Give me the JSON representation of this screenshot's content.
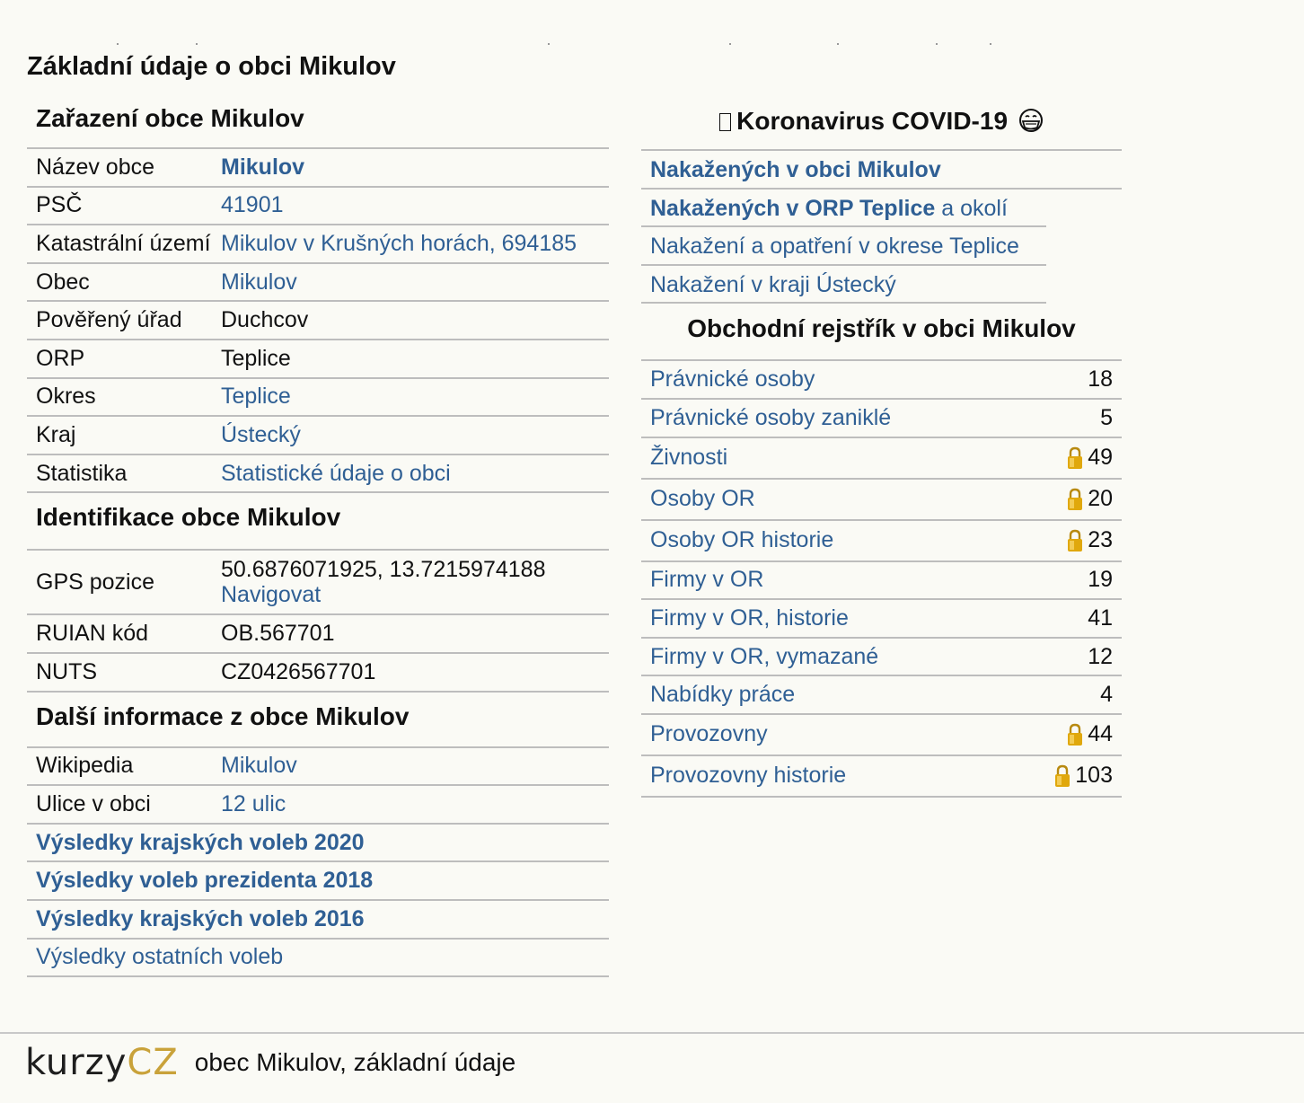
{
  "page_title": "Základní údaje o obci Mikulov",
  "zarazeni": {
    "heading": "Zařazení obce Mikulov",
    "rows": [
      {
        "label": "Název obce",
        "value": "Mikulov",
        "link": true,
        "bold": true
      },
      {
        "label": "PSČ",
        "value": "41901",
        "link": true,
        "bold": false
      },
      {
        "label": "Katastrální území",
        "value": "Mikulov v Krušných horách, 694185",
        "link": true,
        "bold": false
      },
      {
        "label": "Obec",
        "value": "Mikulov",
        "link": true,
        "bold": false
      },
      {
        "label": "Pověřený úřad",
        "value": "Duchcov",
        "link": false,
        "bold": false
      },
      {
        "label": "ORP",
        "value": "Teplice",
        "link": false,
        "bold": false
      },
      {
        "label": "Okres",
        "value": "Teplice",
        "link": true,
        "bold": false
      },
      {
        "label": "Kraj",
        "value": "Ústecký",
        "link": true,
        "bold": false
      },
      {
        "label": "Statistika",
        "value": "Statistické údaje o obci",
        "link": true,
        "bold": false
      }
    ]
  },
  "identifikace": {
    "heading": "Identifikace obce Mikulov",
    "gps_label": "GPS pozice",
    "gps_value": "50.6876071925, 13.7215974188",
    "gps_link": "Navigovat",
    "ruian_label": "RUIAN kód",
    "ruian_value": "OB.567701",
    "nuts_label": "NUTS",
    "nuts_value": "CZ0426567701"
  },
  "dalsi": {
    "heading": "Další informace z obce Mikulov",
    "wiki_label": "Wikipedia",
    "wiki_value": "Mikulov",
    "ulice_label": "Ulice v obci",
    "ulice_value": "12 ulic",
    "links": [
      {
        "text": "Výsledky krajských voleb 2020",
        "bold": true
      },
      {
        "text": "Výsledky voleb prezidenta 2018",
        "bold": true
      },
      {
        "text": "Výsledky krajských voleb 2016",
        "bold": true
      },
      {
        "text": "Výsledky ostatních voleb",
        "bold": false
      }
    ]
  },
  "covid": {
    "heading": "Koronavirus COVID-19",
    "icon": "face-with-mask-icon",
    "rows": [
      {
        "bold_part": "Nakažených v obci Mikulov",
        "rest": ""
      },
      {
        "bold_part": "Nakažených v ORP Teplice",
        "rest": " a okolí"
      },
      {
        "bold_part": "",
        "rest": "Nakažení a opatření v okrese Teplice"
      },
      {
        "bold_part": "",
        "rest": "Nakažení v kraji Ústecký"
      }
    ]
  },
  "obchodni_rejstrik": {
    "heading": "Obchodní rejstřík v obci Mikulov",
    "rows": [
      {
        "name": "Právnické osoby",
        "count": "18",
        "locked": false
      },
      {
        "name": "Právnické osoby zaniklé",
        "count": "5",
        "locked": false
      },
      {
        "name": "Živnosti",
        "count": "49",
        "locked": true
      },
      {
        "name": "Osoby OR",
        "count": "20",
        "locked": true
      },
      {
        "name": "Osoby OR historie",
        "count": "23",
        "locked": true
      },
      {
        "name": "Firmy v OR",
        "count": "19",
        "locked": false
      },
      {
        "name": "Firmy v OR, historie",
        "count": "41",
        "locked": false
      },
      {
        "name": "Firmy v OR, vymazané",
        "count": "12",
        "locked": false
      },
      {
        "name": "Nabídky práce",
        "count": "4",
        "locked": false
      },
      {
        "name": "Provozovny",
        "count": "44",
        "locked": true
      },
      {
        "name": "Provozovny historie",
        "count": "103",
        "locked": true
      }
    ]
  },
  "footer": {
    "logo_part1": "KURZY",
    "logo_part2": "CZ",
    "text": "obec Mikulov, základní údaje"
  },
  "colors": {
    "link": "#2f5f94",
    "background": "#fafaf5",
    "border": "#bdbdbd",
    "lock": "#e0a80c",
    "logo_accent": "#c9a23a"
  }
}
